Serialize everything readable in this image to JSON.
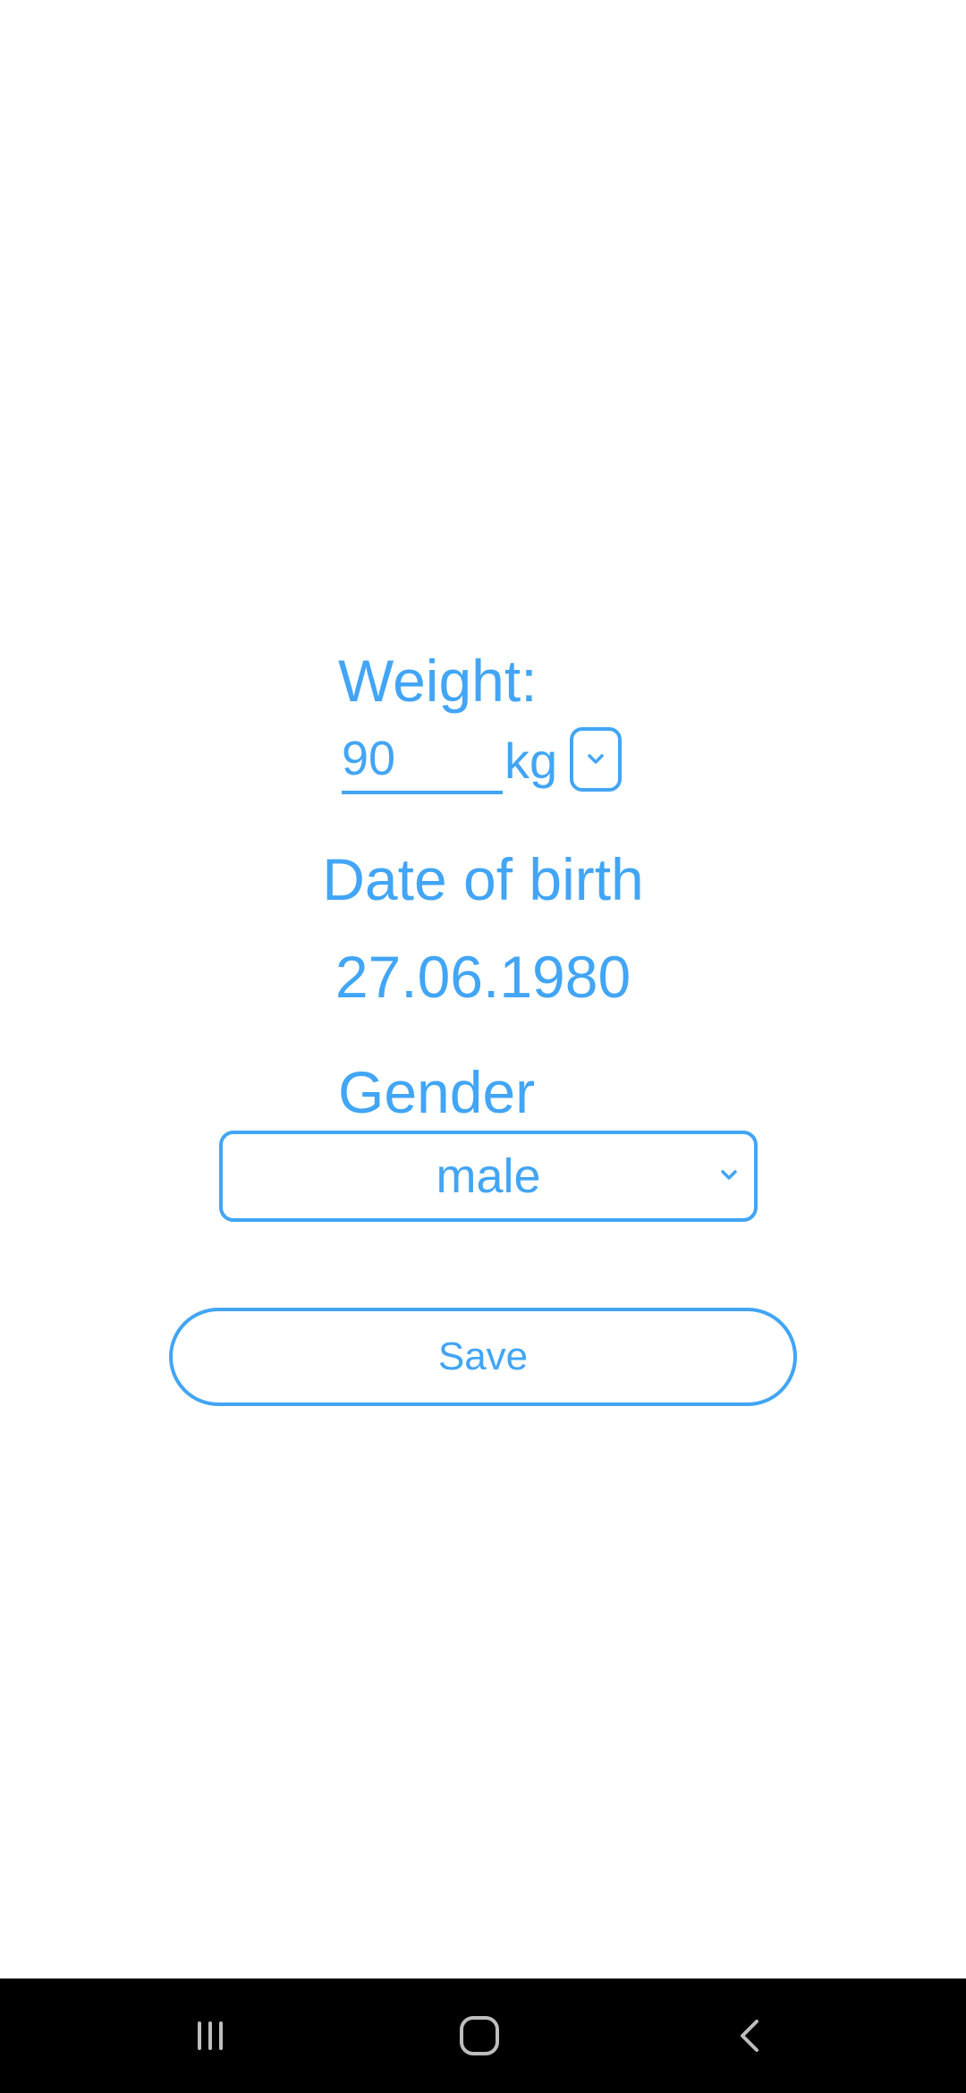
{
  "form": {
    "weight_label": "Weight:",
    "weight_value": "90",
    "weight_unit": "kg",
    "dob_label": "Date of birth",
    "dob_value": "27.06.1980",
    "gender_label": "Gender",
    "gender_selected": "male",
    "save_label": "Save"
  },
  "icons": {
    "unit_dropdown": "chevron-down-icon",
    "gender_dropdown": "chevron-down-icon",
    "nav_recents": "recents-icon",
    "nav_home": "home-icon",
    "nav_back": "back-icon"
  },
  "colors": {
    "accent": "#42A5F5",
    "background": "#FFFFFF",
    "navbar": "#000000",
    "nav_icon": "#BDBDBD"
  }
}
